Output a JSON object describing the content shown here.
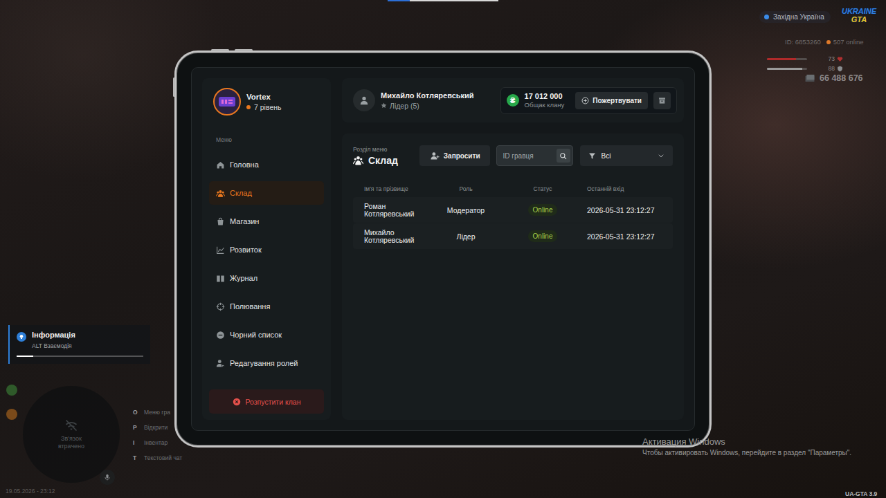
{
  "hud": {
    "region": "Західна Україна",
    "logo_top": "UKRAINE",
    "logo_bottom": "GTA",
    "id": "ID: 6853260",
    "online": "507 online",
    "health": {
      "reading": "73",
      "level": 0.73
    },
    "armor": {
      "reading": "88",
      "level": 0.88
    },
    "money": "66 488 676"
  },
  "tablet": {
    "profile": {
      "name": "Vortex",
      "level": "7 рівень"
    },
    "menu_label": "Меню",
    "sidebar": {
      "items": [
        {
          "label": "Головна",
          "selected": false
        },
        {
          "label": "Склад",
          "selected": true
        },
        {
          "label": "Магазин",
          "selected": false
        },
        {
          "label": "Розвиток",
          "selected": false
        },
        {
          "label": "Журнал",
          "selected": false
        },
        {
          "label": "Полювання",
          "selected": false
        },
        {
          "label": "Чорний список",
          "selected": false
        },
        {
          "label": "Редагування ролей",
          "selected": false
        }
      ]
    },
    "disband_button": "Розпустити клан",
    "user": {
      "name": "Михайло Котляревський",
      "role": "Лідер (5)"
    },
    "treasury": {
      "currency": "₴",
      "amount": "17 012 000",
      "label": "Общак клану"
    },
    "donate_button": "Пожертвувати",
    "section": {
      "caption": "Розділ меню",
      "title": "Склад"
    },
    "invite_button": "Запросити",
    "search": {
      "placeholder": "ID гравця"
    },
    "filter": {
      "value": "Всі"
    },
    "table": {
      "columns": [
        "Ім'я та прізвище",
        "Роль",
        "Статус",
        "Останній вхід"
      ],
      "rows": [
        {
          "name": "Роман Котляревський",
          "role": "Модератор",
          "status": "Online",
          "online": true,
          "last_login": "2026-05-31 23:12:27"
        },
        {
          "name": "Михайло Котляревський",
          "role": "Лідер",
          "status": "Online",
          "online": true,
          "last_login": "2026-05-31 23:12:27"
        }
      ]
    }
  },
  "info_toast": {
    "title": "Інформація",
    "text": "ALT Взаємодія",
    "level": 0.13
  },
  "minimap": {
    "text": "Зв'язок втрачено"
  },
  "hints": [
    {
      "key": "O",
      "label": "Меню гра"
    },
    {
      "key": "P",
      "label": "Відкрити"
    },
    {
      "key": "I",
      "label": "Інвентар"
    },
    {
      "key": "T",
      "label": "Текстовий чат"
    }
  ],
  "datetime": "19.05.2026 - 23:12",
  "watermark": {
    "title": "Активация Windows",
    "text": "Чтобы активировать Windows, перейдите в раздел \"Параметры\"."
  },
  "version": "UA-GTA 3.9"
}
